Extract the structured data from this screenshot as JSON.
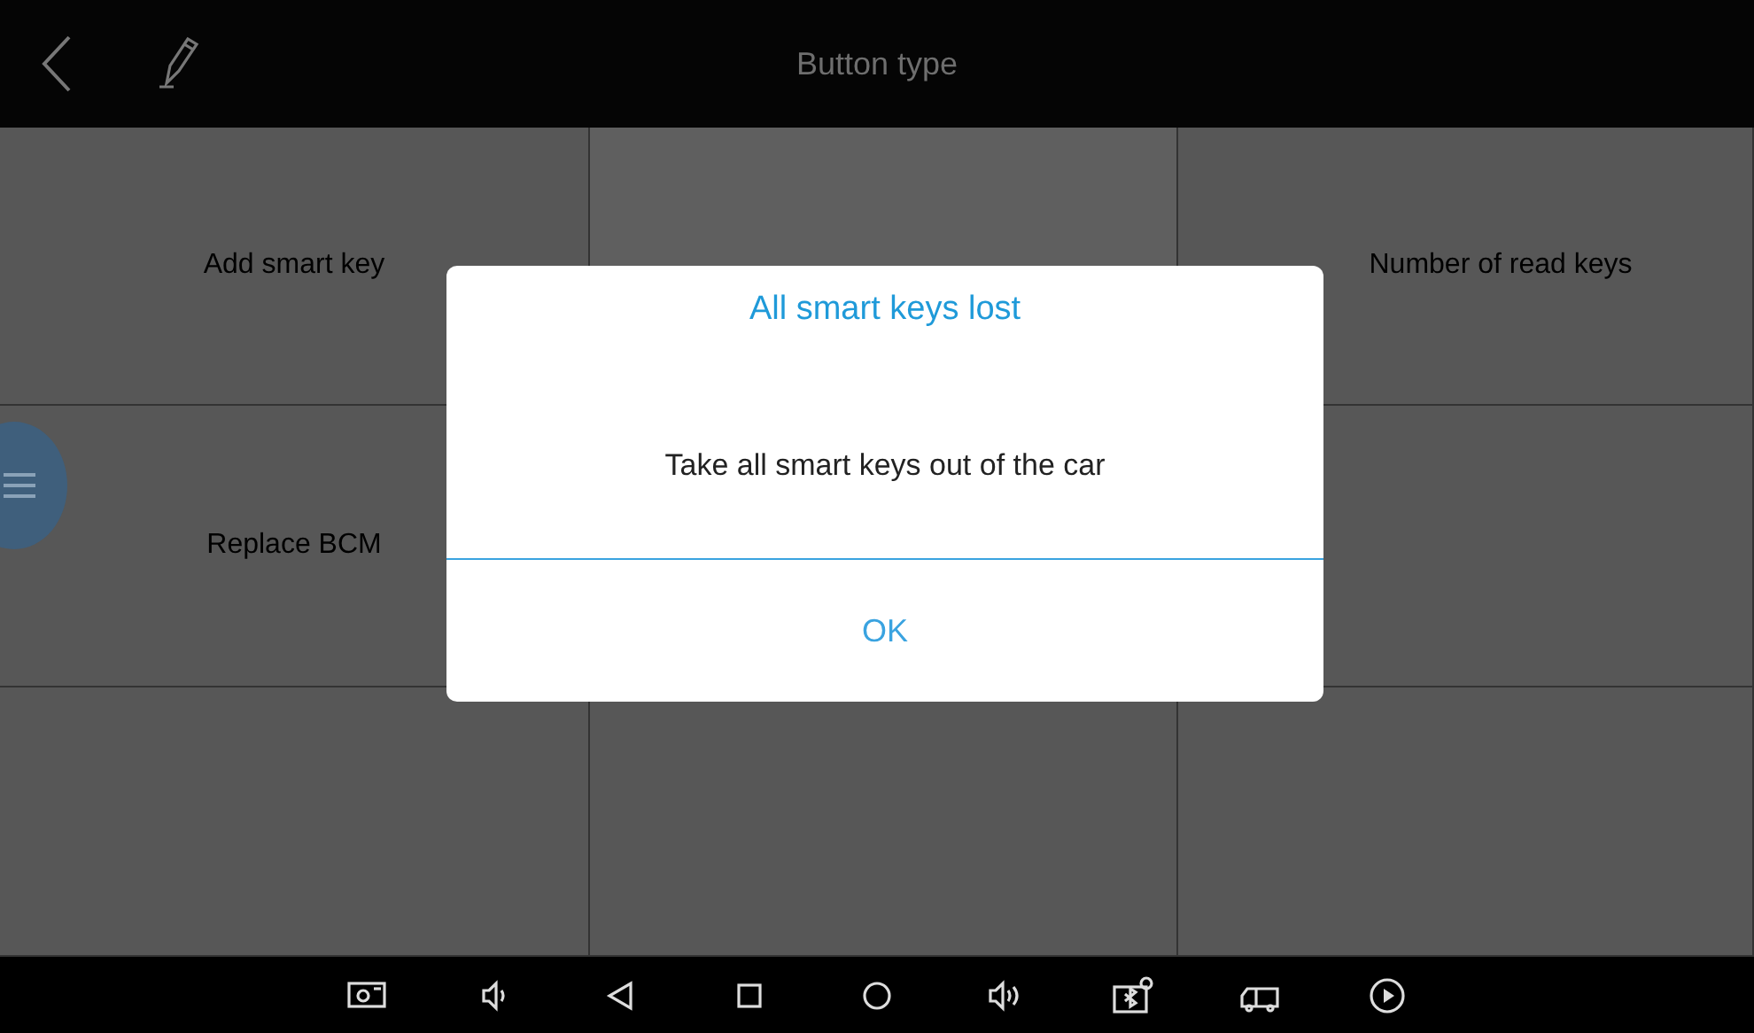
{
  "top_bar": {
    "title": "Button type"
  },
  "tiles": [
    {
      "label": "Add smart key"
    },
    {
      "label": "Number of read keys"
    },
    {
      "label": "Replace BCM"
    }
  ],
  "dialog": {
    "title": "All smart keys lost",
    "message": "Take all smart keys out of the car",
    "button": "OK"
  }
}
